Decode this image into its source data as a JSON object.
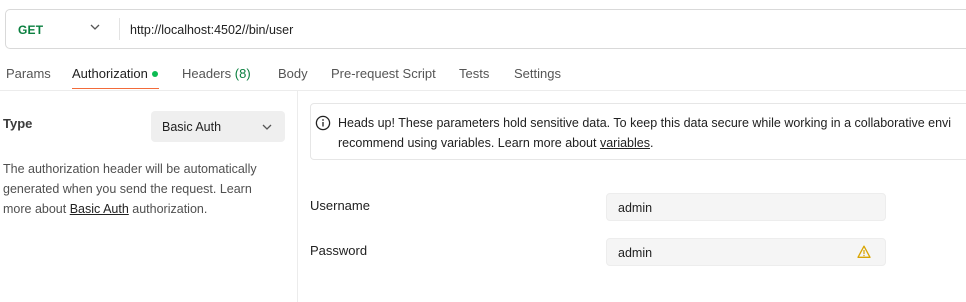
{
  "request": {
    "method": "GET",
    "url": "http://localhost:4502//bin/user"
  },
  "tabs": [
    {
      "label": "Params"
    },
    {
      "label": "Authorization",
      "active": true,
      "indicator": "green-dot"
    },
    {
      "label": "Headers",
      "count": "(8)"
    },
    {
      "label": "Body"
    },
    {
      "label": "Pre-request Script"
    },
    {
      "label": "Tests"
    },
    {
      "label": "Settings"
    }
  ],
  "auth": {
    "type_label": "Type",
    "type_value": "Basic Auth",
    "description_pre": "The authorization header will be automatically generated when you send the request. Learn more about ",
    "description_link": "Basic Auth",
    "description_post": " authorization."
  },
  "notice": {
    "icon": "info-icon",
    "line1": "Heads up! These parameters hold sensitive data. To keep this data secure while working in a collaborative envi",
    "line2_pre": "recommend using variables. Learn more about ",
    "line2_link": "variables",
    "line2_post": "."
  },
  "fields": {
    "username": {
      "label": "Username",
      "value": "admin"
    },
    "password": {
      "label": "Password",
      "value": "admin",
      "icon": "warning-icon"
    }
  },
  "colors": {
    "method_get": "#0a7f3f",
    "active_tab_underline": "#f26b3a",
    "status_dot": "#0cbb52",
    "warning": "#d9a400"
  }
}
